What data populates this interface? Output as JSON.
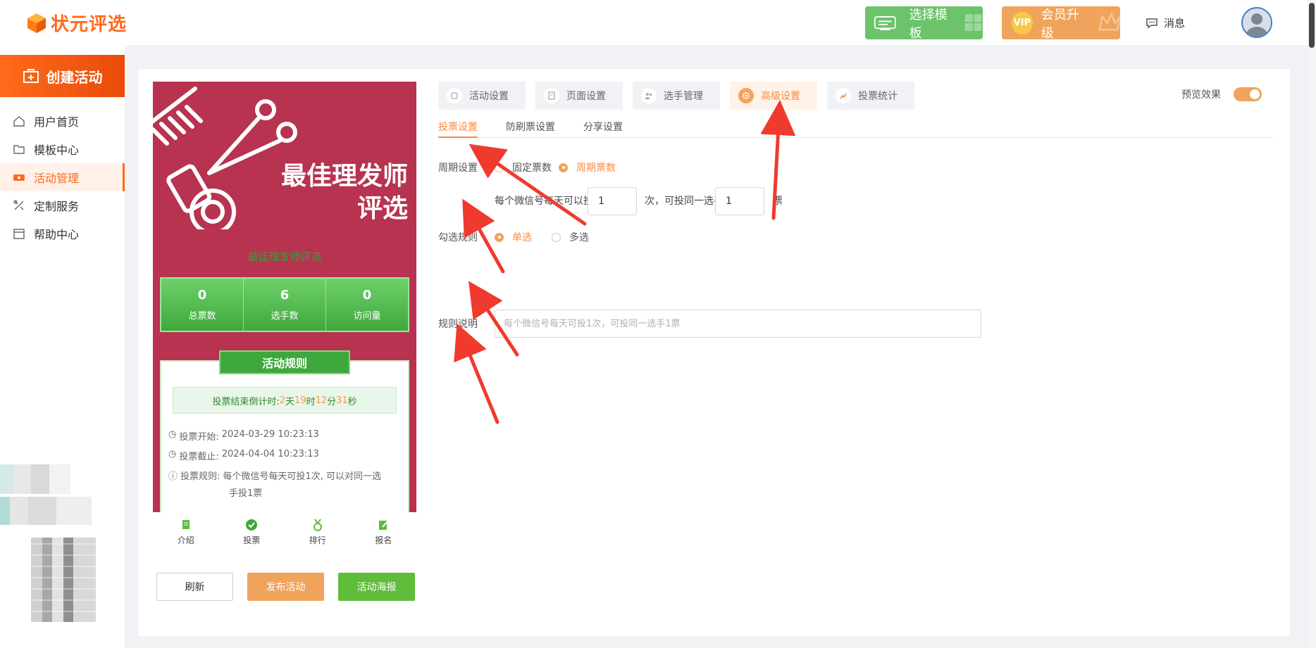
{
  "header": {
    "logo_text": "状元评选",
    "template_button": "选择模板",
    "vip_badge": "VIP",
    "vip_button": "会员升级",
    "message_label": "消息"
  },
  "sidebar": {
    "create_label": "创建活动",
    "items": [
      {
        "label": "用户首页",
        "icon": "home-icon"
      },
      {
        "label": "模板中心",
        "icon": "folder-icon"
      },
      {
        "label": "活动管理",
        "icon": "ticket-icon",
        "active": true
      },
      {
        "label": "定制服务",
        "icon": "tools-icon"
      },
      {
        "label": "帮助中心",
        "icon": "box-icon"
      }
    ]
  },
  "preview": {
    "poster_title_line1": "最佳理发师",
    "poster_title_line2": "评选",
    "sub_title": "最佳理发师评选",
    "stats": [
      {
        "value": "0",
        "label": "总票数"
      },
      {
        "value": "6",
        "label": "选手数"
      },
      {
        "value": "0",
        "label": "访问量"
      }
    ],
    "rules_title": "活动规则",
    "countdown": {
      "prefix": "投票结束倒计时:",
      "days": "2",
      "days_unit": "天",
      "hours": "19",
      "hours_unit": "时",
      "minutes": "12",
      "minutes_unit": "分",
      "seconds": "31",
      "seconds_unit": "秒"
    },
    "start_label": "投票开始:",
    "start_time": "2024-03-29 10:23:13",
    "end_label": "投票截止:",
    "end_time": "2024-04-04 10:23:13",
    "rule_label": "投票规则:",
    "rule_text_1": "每个微信号每天可投1次, 可以对同一选",
    "rule_text_2": "手投1票",
    "tabs": [
      "介绍",
      "投票",
      "排行",
      "报名"
    ],
    "buttons": {
      "refresh": "刷新",
      "publish": "发布活动",
      "poster": "活动海报"
    }
  },
  "settings": {
    "top_tabs": [
      {
        "label": "活动设置",
        "icon": "settings-icon"
      },
      {
        "label": "页面设置",
        "icon": "page-icon"
      },
      {
        "label": "选手管理",
        "icon": "users-icon"
      },
      {
        "label": "高级设置",
        "icon": "target-icon",
        "active": true
      },
      {
        "label": "投票统计",
        "icon": "stats-icon"
      }
    ],
    "preview_label": "预览效果",
    "preview_enabled": true,
    "sub_tabs": [
      "投票设置",
      "防刷票设置",
      "分享设置"
    ],
    "cycle_label": "周期设置",
    "cycle_options": [
      "固定票数",
      "周期票数"
    ],
    "cycle_selected": "周期票数",
    "per_day_prefix": "每个微信号每天可以投",
    "per_day_value": "1",
    "per_day_mid": "次，可投同一选手",
    "per_player_value": "1",
    "per_player_unit": "票",
    "select_rule_label": "勾选规则",
    "select_options": [
      "单选",
      "多选"
    ],
    "select_selected": "单选",
    "desc_label": "规则说明",
    "desc_placeholder": "每个微信号每天可投1次，可投同一选手1票"
  },
  "colors": {
    "brand": "#ff6a1a",
    "accent": "#f0a35a",
    "green": "#6cc36a",
    "poster_bg": "#b73350",
    "arrow": "#f03a2e"
  }
}
